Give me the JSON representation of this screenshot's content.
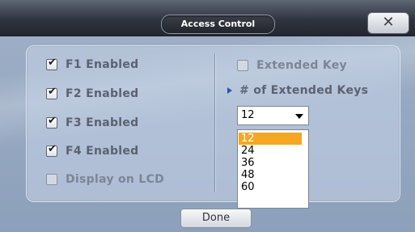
{
  "dialog": {
    "title": "Access Control",
    "close_label": "✕",
    "done_label": "Done"
  },
  "left_options": [
    {
      "label": "F1 Enabled",
      "checked": true
    },
    {
      "label": "F2 Enabled",
      "checked": true
    },
    {
      "label": "F3 Enabled",
      "checked": true
    },
    {
      "label": "F4 Enabled",
      "checked": true
    },
    {
      "label": "Display on LCD",
      "checked": false
    }
  ],
  "extended": {
    "checkbox_label": "Extended Key",
    "checked": false,
    "count_label": "# of Extended Keys",
    "selected_value": "12",
    "options": [
      "12",
      "24",
      "36",
      "48",
      "60"
    ],
    "highlight_color": "#f5a623"
  },
  "icons": {
    "close": "close-icon",
    "expander": "triangle-right-icon",
    "dropdown": "chevron-down-icon"
  }
}
